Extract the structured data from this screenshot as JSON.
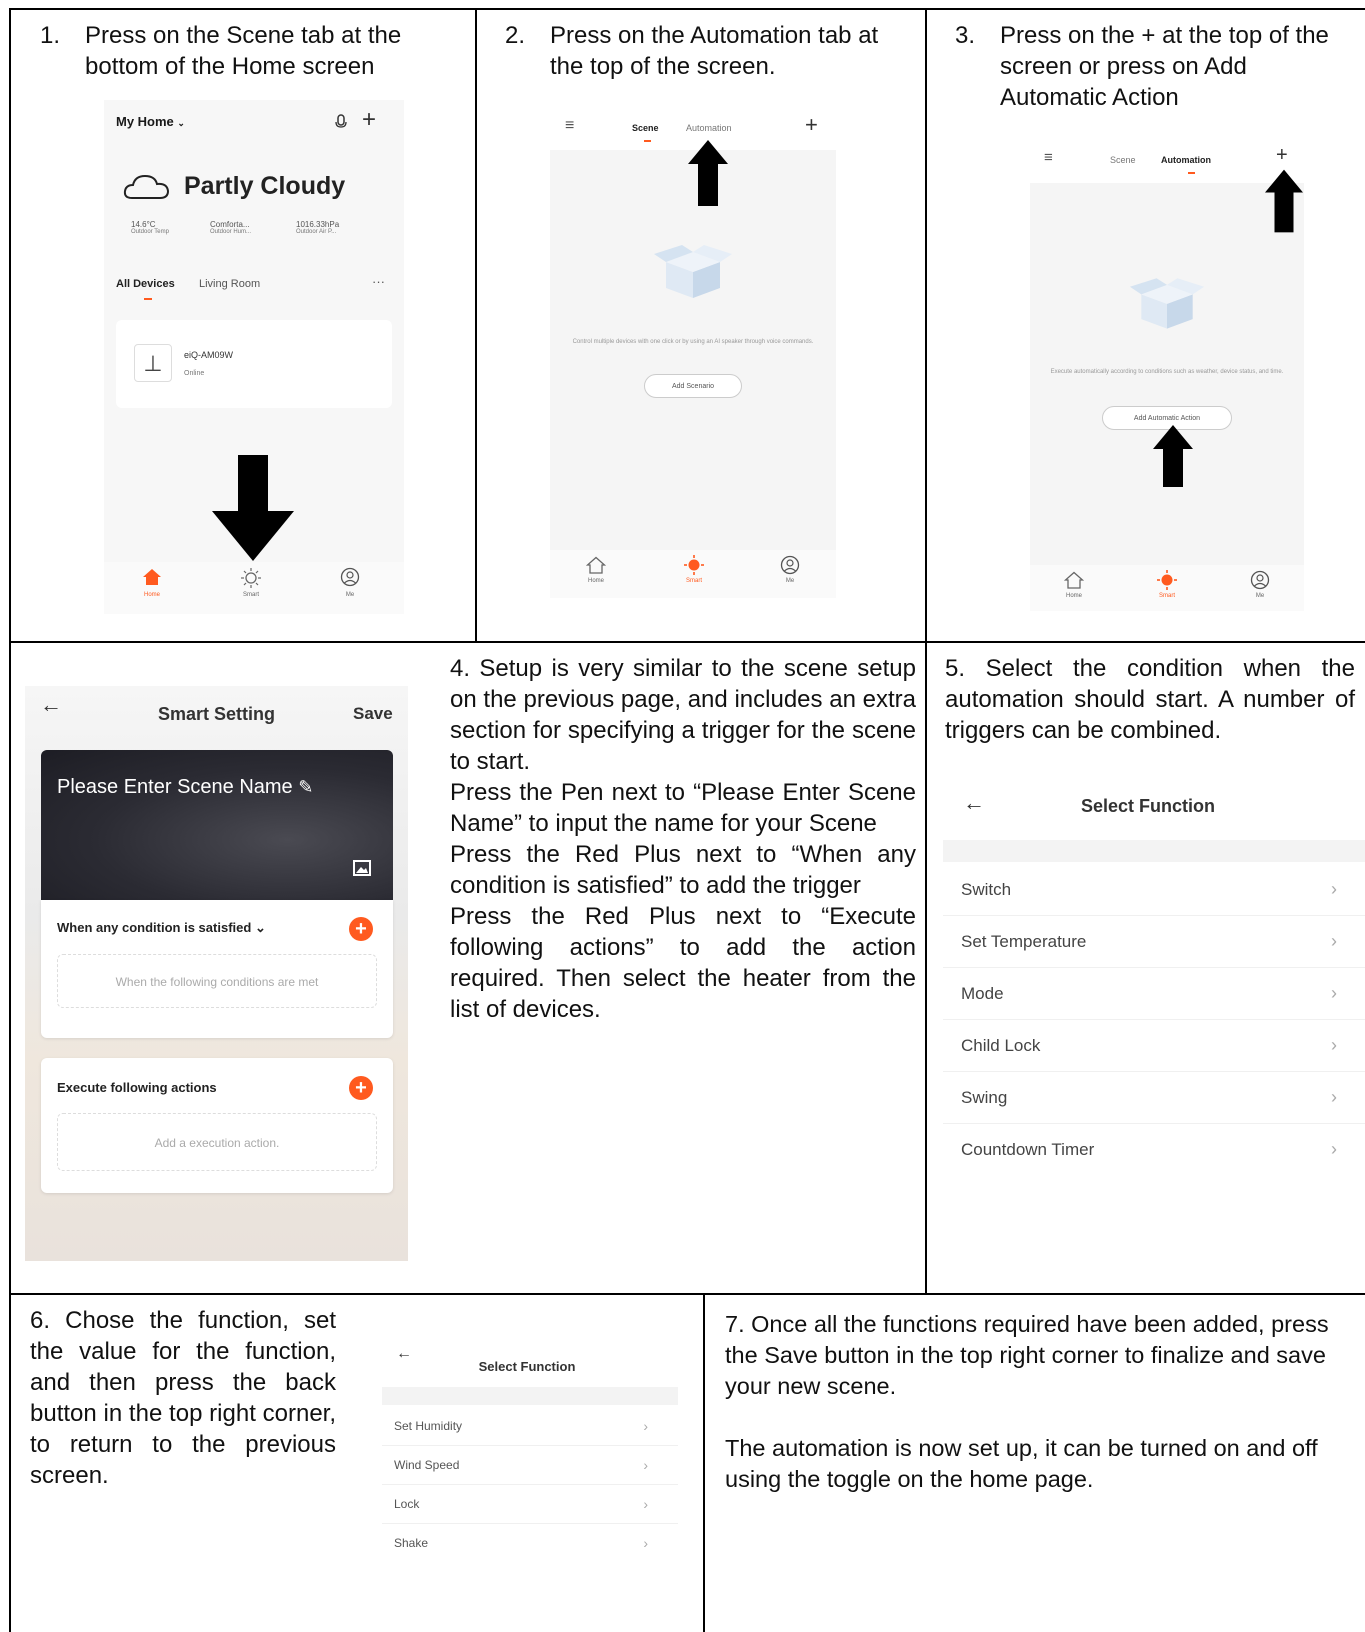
{
  "step1": {
    "num": "1.",
    "text": "Press on the Scene tab at the bottom of the Home screen",
    "phone": {
      "home_title": "My Home",
      "weather": "Partly Cloudy",
      "stats": [
        {
          "value": "14.6°C",
          "label": "Outdoor Temp"
        },
        {
          "value": "Comforta...",
          "label": "Outdoor Hum..."
        },
        {
          "value": "1016.33hPa",
          "label": "Outdoor Air P..."
        }
      ],
      "tabs": [
        "All Devices",
        "Living Room"
      ],
      "more": "···",
      "device_name": "eiQ-AM09W",
      "device_status": "Online",
      "nav": [
        "Home",
        "Smart",
        "Me"
      ]
    }
  },
  "step2": {
    "num": "2.",
    "text": "Press on the Automation tab at the top of the screen.",
    "phone": {
      "tabs": [
        "Scene",
        "Automation"
      ],
      "empty_text": "Control multiple devices with one click or by using an AI speaker through voice commands.",
      "button": "Add Scenario",
      "nav": [
        "Home",
        "Smart",
        "Me"
      ]
    }
  },
  "step3": {
    "num": "3.",
    "text": "Press on the + at the top of the screen or press on Add Automatic Action",
    "phone": {
      "tabs": [
        "Scene",
        "Automation"
      ],
      "empty_text": "Execute automatically according to conditions such as weather, device status, and time.",
      "button": "Add Automatic Action",
      "nav": [
        "Home",
        "Smart",
        "Me"
      ]
    }
  },
  "step4": {
    "p1": "4. Setup is very similar to the scene setup on the previous page, and includes an extra section for specifying a trigger for the scene to start.",
    "p2": "Press the Pen next to “Please Enter Scene Name” to input the name for your Scene",
    "p3": "Press the Red Plus next to “When any condition is satisfied” to add the trigger",
    "p4": "Press the Red Plus next to “Execute following actions” to add the action required.  Then select the heater from the list of devices.",
    "phone": {
      "title": "Smart Setting",
      "save": "Save",
      "scene_name": "Please Enter Scene Name",
      "condition_header": "When any condition is satisfied",
      "condition_placeholder": "When the following conditions are met",
      "action_header": "Execute following actions",
      "action_placeholder": "Add a execution action."
    }
  },
  "step5": {
    "text": "5. Select the condition when the automation should start.  A number of triggers can be combined.",
    "screen": {
      "title": "Select Function",
      "items": [
        "Switch",
        "Set Temperature",
        "Mode",
        "Child Lock",
        "Swing",
        "Countdown Timer"
      ]
    }
  },
  "step6": {
    "text": "6. Chose the function, set the value for the function, and then press the back button in the top right corner, to return to the previous screen.",
    "screen": {
      "title": "Select Function",
      "items": [
        "Set Humidity",
        "Wind Speed",
        "Lock",
        "Shake"
      ]
    }
  },
  "step7": {
    "num": "7.",
    "p1": "Once all the functions required have been added, press the Save button in the top right corner to finalize and save your new scene.",
    "p2": "The automation is now set up, it can be turned on and off using the toggle on the home page."
  },
  "colors": {
    "accent": "#ff5a1f"
  },
  "icons": [
    "back-arrow-icon",
    "chevron-right-icon",
    "plus-icon",
    "microphone-icon",
    "cloud-icon",
    "home-icon",
    "sun-icon",
    "person-icon",
    "hamburger-icon",
    "pen-icon",
    "image-icon",
    "box-icon"
  ]
}
